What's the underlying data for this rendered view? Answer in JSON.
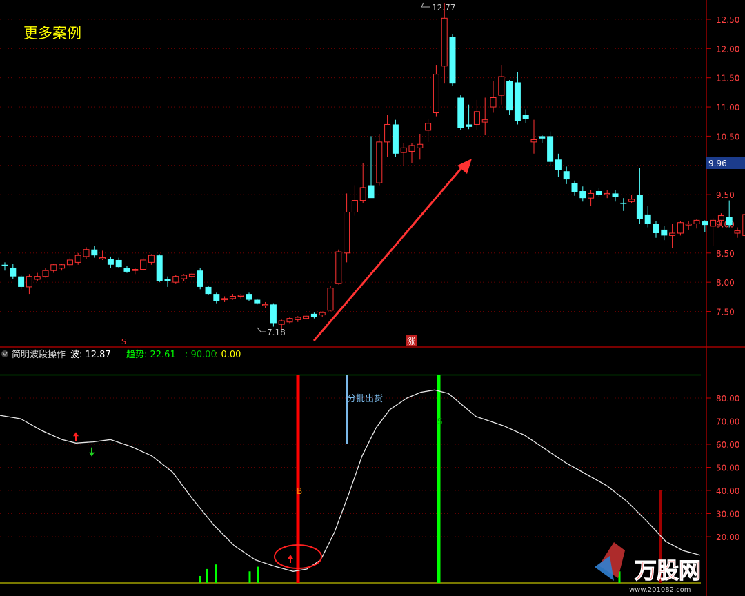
{
  "header": {
    "title": "更多案例",
    "indicator_name": "简明波段操作",
    "wave_label": "波: 12.87",
    "trend_label": "趋势: 22.61",
    "val90_label": ": 90.00",
    "val0_label": ": 0.00"
  },
  "annotations": {
    "high_label": "12.77",
    "low_label": "7.18",
    "current_price": "9.96",
    "s_marker": "S",
    "zhang_marker": "涨",
    "sell_label": "分批出货",
    "b_label": "B",
    "s_label2": "S"
  },
  "watermark": {
    "brand": "万股网",
    "url": "www.201082.com"
  },
  "colors": {
    "up": "#ff3232",
    "down": "#54ffff",
    "grid": "#800000",
    "title": "#ffff00",
    "indicator_line": "#e6e6e6",
    "buy_bar": "#ff0000",
    "sell_bar": "#00ff00",
    "level90": "#00c000",
    "level0": "#c0c000",
    "dist_bar": "#7ab8e8",
    "dark_red_bar": "#a00000"
  },
  "chart_data": [
    {
      "type": "candlestick",
      "yticks": [
        "12.50",
        "12.00",
        "11.50",
        "11.00",
        "10.50",
        "10.00",
        "9.50",
        "9.00",
        "8.50",
        "8.00",
        "7.50"
      ],
      "ylim": [
        7.0,
        12.85
      ],
      "candles": [
        [
          8.3,
          8.34,
          8.2,
          8.28
        ],
        [
          8.25,
          8.32,
          8.05,
          8.1
        ],
        [
          8.1,
          8.12,
          7.88,
          7.92
        ],
        [
          7.92,
          8.14,
          7.8,
          8.1
        ],
        [
          8.05,
          8.16,
          8.02,
          8.1
        ],
        [
          8.1,
          8.24,
          8.08,
          8.2
        ],
        [
          8.2,
          8.32,
          8.16,
          8.3
        ],
        [
          8.24,
          8.32,
          8.2,
          8.3
        ],
        [
          8.3,
          8.42,
          8.26,
          8.38
        ],
        [
          8.34,
          8.5,
          8.3,
          8.46
        ],
        [
          8.44,
          8.6,
          8.4,
          8.56
        ],
        [
          8.56,
          8.62,
          8.42,
          8.46
        ],
        [
          8.4,
          8.54,
          8.38,
          8.42
        ],
        [
          8.4,
          8.44,
          8.24,
          8.3
        ],
        [
          8.38,
          8.42,
          8.24,
          8.26
        ],
        [
          8.24,
          8.28,
          8.16,
          8.18
        ],
        [
          8.2,
          8.24,
          8.14,
          8.22
        ],
        [
          8.22,
          8.42,
          8.2,
          8.38
        ],
        [
          8.34,
          8.48,
          8.3,
          8.46
        ],
        [
          8.46,
          8.48,
          8.0,
          8.02
        ],
        [
          8.05,
          8.1,
          7.92,
          8.02
        ],
        [
          8.0,
          8.12,
          7.98,
          8.1
        ],
        [
          8.06,
          8.14,
          8.02,
          8.12
        ],
        [
          8.1,
          8.16,
          8.04,
          8.14
        ],
        [
          8.2,
          8.24,
          7.88,
          7.92
        ],
        [
          7.92,
          7.94,
          7.78,
          7.8
        ],
        [
          7.8,
          7.82,
          7.64,
          7.68
        ],
        [
          7.7,
          7.76,
          7.66,
          7.72
        ],
        [
          7.72,
          7.8,
          7.7,
          7.76
        ],
        [
          7.76,
          7.8,
          7.72,
          7.78
        ],
        [
          7.8,
          7.82,
          7.68,
          7.7
        ],
        [
          7.7,
          7.72,
          7.62,
          7.64
        ],
        [
          7.6,
          7.66,
          7.56,
          7.62
        ],
        [
          7.62,
          7.64,
          7.24,
          7.3
        ],
        [
          7.28,
          7.36,
          7.18,
          7.34
        ],
        [
          7.32,
          7.4,
          7.3,
          7.38
        ],
        [
          7.36,
          7.42,
          7.32,
          7.4
        ],
        [
          7.38,
          7.44,
          7.36,
          7.42
        ],
        [
          7.46,
          7.48,
          7.38,
          7.4
        ],
        [
          7.44,
          7.5,
          7.4,
          7.48
        ],
        [
          7.52,
          7.94,
          7.5,
          7.9
        ],
        [
          7.98,
          8.56,
          7.96,
          8.52
        ],
        [
          8.5,
          9.52,
          8.34,
          9.2
        ],
        [
          9.2,
          9.66,
          9.14,
          9.4
        ],
        [
          9.4,
          10.04,
          9.36,
          9.62
        ],
        [
          9.66,
          10.5,
          9.54,
          9.44
        ],
        [
          9.7,
          10.54,
          9.66,
          10.4
        ],
        [
          10.4,
          10.86,
          10.14,
          10.7
        ],
        [
          10.7,
          10.78,
          10.14,
          10.2
        ],
        [
          10.22,
          10.38,
          10.0,
          10.3
        ],
        [
          10.24,
          10.38,
          10.04,
          10.34
        ],
        [
          10.3,
          10.54,
          10.1,
          10.36
        ],
        [
          10.6,
          10.8,
          10.4,
          10.72
        ],
        [
          10.9,
          11.72,
          10.84,
          11.56
        ],
        [
          11.7,
          12.77,
          11.4,
          12.52
        ],
        [
          12.2,
          12.24,
          11.36,
          11.4
        ],
        [
          11.16,
          11.2,
          10.6,
          10.64
        ],
        [
          10.7,
          11.04,
          10.62,
          10.66
        ],
        [
          10.7,
          11.12,
          10.6,
          10.92
        ],
        [
          10.74,
          11.16,
          10.52,
          10.78
        ],
        [
          11.0,
          11.44,
          10.9,
          11.16
        ],
        [
          11.2,
          11.72,
          11.04,
          11.52
        ],
        [
          11.44,
          11.46,
          10.86,
          10.94
        ],
        [
          11.42,
          11.6,
          10.7,
          10.76
        ],
        [
          10.86,
          10.96,
          10.72,
          10.8
        ],
        [
          10.4,
          10.78,
          10.2,
          10.44
        ],
        [
          10.5,
          10.52,
          10.38,
          10.46
        ],
        [
          10.5,
          10.58,
          10.0,
          10.06
        ],
        [
          10.1,
          10.2,
          9.8,
          9.92
        ],
        [
          9.9,
          9.98,
          9.68,
          9.76
        ],
        [
          9.7,
          9.74,
          9.48,
          9.54
        ],
        [
          9.56,
          9.64,
          9.38,
          9.44
        ],
        [
          9.44,
          9.58,
          9.3,
          9.52
        ],
        [
          9.56,
          9.62,
          9.46,
          9.5
        ],
        [
          9.5,
          9.58,
          9.44,
          9.52
        ],
        [
          9.52,
          9.58,
          9.38,
          9.46
        ],
        [
          9.36,
          9.44,
          9.22,
          9.34
        ],
        [
          9.38,
          9.5,
          9.36,
          9.42
        ],
        [
          9.5,
          9.96,
          9.0,
          9.08
        ],
        [
          9.16,
          9.3,
          8.94,
          9.0
        ],
        [
          9.0,
          9.04,
          8.76,
          8.84
        ],
        [
          8.9,
          8.96,
          8.72,
          8.8
        ],
        [
          8.8,
          9.0,
          8.58,
          8.84
        ],
        [
          8.84,
          9.04,
          8.8,
          9.02
        ],
        [
          8.98,
          9.04,
          8.9,
          9.0
        ],
        [
          9.0,
          9.08,
          8.92,
          9.06
        ],
        [
          9.04,
          9.06,
          8.86,
          8.98
        ],
        [
          8.96,
          9.1,
          8.62,
          9.06
        ],
        [
          9.06,
          9.18,
          8.96,
          9.14
        ],
        [
          9.12,
          9.4,
          8.94,
          8.98
        ],
        [
          8.84,
          8.94,
          8.76,
          8.88
        ],
        [
          8.8,
          9.2,
          8.78,
          9.16
        ],
        [
          9.14,
          9.56,
          9.04,
          9.0
        ],
        [
          9.08,
          9.46,
          9.04,
          9.42
        ]
      ]
    },
    {
      "type": "line",
      "yticks": [
        "80.00",
        "70.00",
        "60.00",
        "50.00",
        "40.00",
        "30.00",
        "20.00"
      ],
      "ylim": [
        0,
        100
      ],
      "wave": [
        [
          0,
          72.5
        ],
        [
          30,
          71
        ],
        [
          60,
          66
        ],
        [
          90,
          62
        ],
        [
          110,
          60.5
        ],
        [
          135,
          61
        ],
        [
          160,
          62
        ],
        [
          190,
          59
        ],
        [
          220,
          55
        ],
        [
          250,
          48
        ],
        [
          280,
          36
        ],
        [
          310,
          25
        ],
        [
          340,
          16
        ],
        [
          370,
          10
        ],
        [
          400,
          7
        ],
        [
          425,
          5
        ],
        [
          445,
          6
        ],
        [
          465,
          10
        ],
        [
          485,
          22
        ],
        [
          505,
          38
        ],
        [
          525,
          55
        ],
        [
          545,
          67
        ],
        [
          565,
          75
        ],
        [
          590,
          80
        ],
        [
          610,
          82.5
        ],
        [
          630,
          83.5
        ],
        [
          650,
          82
        ],
        [
          670,
          77
        ],
        [
          690,
          72
        ],
        [
          710,
          70
        ],
        [
          730,
          68
        ],
        [
          760,
          64
        ],
        [
          790,
          58
        ],
        [
          820,
          52
        ],
        [
          850,
          47
        ],
        [
          880,
          42
        ],
        [
          910,
          35
        ],
        [
          940,
          26
        ],
        [
          965,
          18
        ],
        [
          990,
          14
        ],
        [
          1015,
          12
        ]
      ],
      "buy_bar": {
        "x": 432,
        "to": 90
      },
      "sell_bar": {
        "x": 636,
        "to": 90
      },
      "dist_bar": {
        "x": 503,
        "from": 60,
        "to": 90
      },
      "dark_red_bar": {
        "x": 958,
        "from": 0,
        "to": 40
      },
      "green_bars": [
        {
          "x": 290,
          "h": 3
        },
        {
          "x": 300,
          "h": 6
        },
        {
          "x": 313,
          "h": 8
        },
        {
          "x": 362,
          "h": 5
        },
        {
          "x": 374,
          "h": 7
        },
        {
          "x": 898,
          "h": 5
        }
      ],
      "arrow_up_at": {
        "x": 110,
        "y": 62
      },
      "arrow_down_at": {
        "x": 133,
        "y": 58
      },
      "level_high": 90,
      "level_low": 0
    }
  ]
}
